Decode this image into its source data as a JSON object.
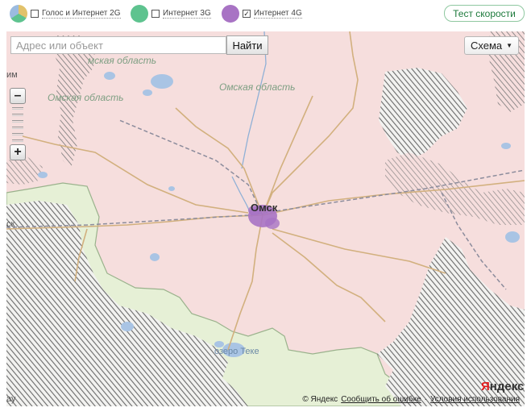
{
  "legend": {
    "items": [
      {
        "label": "Голос и Интернет 2G",
        "checked": false,
        "color": "#e2c26b"
      },
      {
        "label": "Интернет 3G",
        "checked": false,
        "color": "#5ec38f"
      },
      {
        "label": "Интернет 4G",
        "checked": true,
        "color": "#a873c4",
        "check_mark": "✓"
      }
    ]
  },
  "speed_test": {
    "label": "Тест скорости"
  },
  "map": {
    "search": {
      "placeholder": "Адрес или объект",
      "value": ""
    },
    "find_label": "Найти",
    "scheme_label": "Схема",
    "zoom_in": "+",
    "zoom_out": "–",
    "region_labels": [
      "мская область",
      "Омская область",
      "Омская область"
    ],
    "edge_labels": [
      "им",
      "ск",
      "ау"
    ],
    "city": "Омск",
    "lake": "озеро Теке",
    "logo": {
      "first": "Я",
      "rest": "ндекс"
    },
    "footer": {
      "copyright": "© Яндекс",
      "report": "Сообщить об ошибке",
      "terms": "Условия использования"
    },
    "colors": {
      "land": "#f6dedd",
      "green_zone": "#e6f0d6",
      "border": "#9ab28c",
      "road": "#d2b07e",
      "railway": "#8c8c9c",
      "water": "#a9c4e4",
      "hatch": "#6a6a6a",
      "lte_coverage": "#a873c4"
    }
  }
}
